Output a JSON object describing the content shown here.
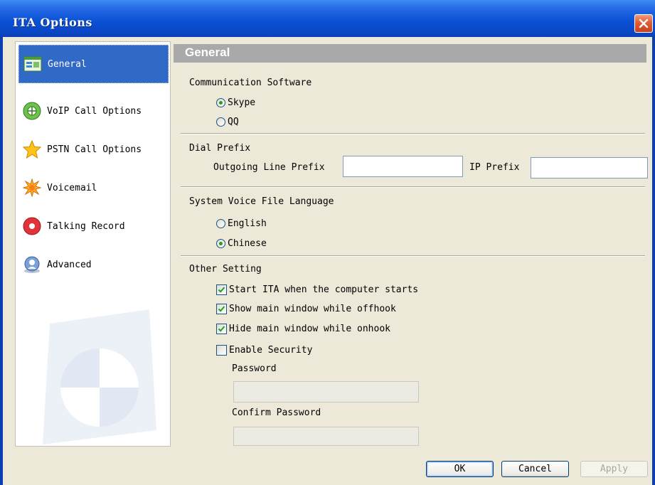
{
  "window": {
    "title": "ITA Options"
  },
  "sidebar": {
    "items": [
      {
        "label": "General",
        "icon": "general-icon"
      },
      {
        "label": "VoIP Call Options",
        "icon": "voip-icon"
      },
      {
        "label": "PSTN Call Options",
        "icon": "star-icon"
      },
      {
        "label": "Voicemail",
        "icon": "voicemail-icon"
      },
      {
        "label": "Talking Record",
        "icon": "record-icon"
      },
      {
        "label": "Advanced",
        "icon": "advanced-icon"
      }
    ],
    "selected": "General"
  },
  "main": {
    "header": "General",
    "communication": {
      "label": "Communication Software",
      "options": [
        "Skype",
        "QQ"
      ],
      "selected": "Skype"
    },
    "dial_prefix": {
      "label": "Dial Prefix",
      "outgoing_label": "Outgoing Line Prefix",
      "outgoing_value": "",
      "ip_label": "IP Prefix",
      "ip_value": ""
    },
    "language": {
      "label": "System Voice File Language",
      "options": [
        "English",
        "Chinese"
      ],
      "selected": "Chinese"
    },
    "other": {
      "label": "Other Setting",
      "start_ita": {
        "label": "Start ITA when the computer starts",
        "checked": true
      },
      "show_main": {
        "label": "Show main window while offhook",
        "checked": true
      },
      "hide_main": {
        "label": "Hide main window while onhook",
        "checked": true
      },
      "security": {
        "label": "Enable Security",
        "checked": false
      },
      "password_label": "Password",
      "password_value": "",
      "confirm_label": "Confirm Password",
      "confirm_value": ""
    }
  },
  "buttons": {
    "ok": "OK",
    "cancel": "Cancel",
    "apply": "Apply"
  },
  "colors": {
    "titlebar": "#0a47c7",
    "selection": "#3169c6",
    "dialog_bg": "#ece9d8",
    "header_bar": "#a9a9a9"
  }
}
